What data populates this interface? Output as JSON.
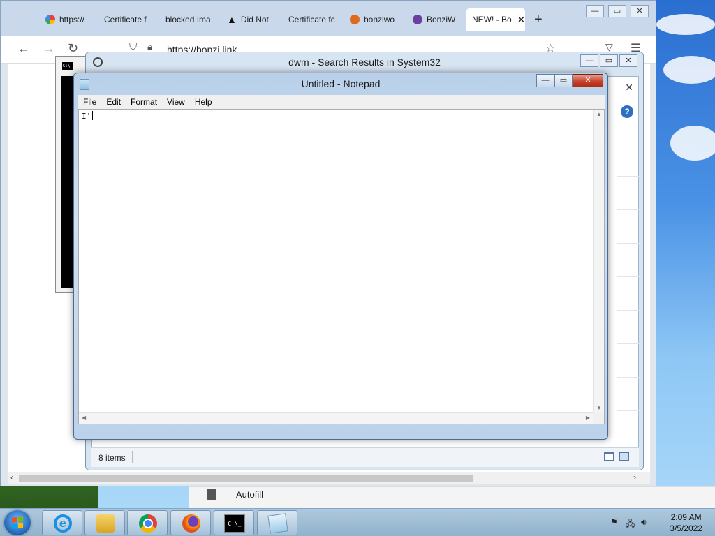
{
  "browser": {
    "tabs": [
      {
        "label": "https://",
        "icon": "google-icon"
      },
      {
        "label": "Certificate f",
        "icon": ""
      },
      {
        "label": "blocked Ima",
        "icon": ""
      },
      {
        "label": "Did Not",
        "icon": "warning-icon"
      },
      {
        "label": "Certificate fc",
        "icon": ""
      },
      {
        "label": "bonziwo",
        "icon": "bonzi-icon"
      },
      {
        "label": "BonziW",
        "icon": "bonzi-purple-icon"
      },
      {
        "label": "NEW! - Bo",
        "icon": "",
        "active": true
      }
    ],
    "new_tab": "+",
    "url": "https://bonzi.link",
    "autofill_label": "Autofill"
  },
  "explorer": {
    "title": "dwm - Search Results in System32",
    "status_items": "8 items"
  },
  "notepad": {
    "title": "Untitled - Notepad",
    "menu": [
      "File",
      "Edit",
      "Format",
      "View",
      "Help"
    ],
    "content": "I'"
  },
  "cmd": {
    "icon_text": "C:\\_"
  },
  "taskbar": {
    "cmd_icon_text": "C:\\_",
    "ie_letter": "e",
    "clock_time": "2:09 AM",
    "clock_date": "3/5/2022"
  },
  "colors": {
    "accent": "#2b6fc0",
    "close_red": "#c7432b"
  }
}
